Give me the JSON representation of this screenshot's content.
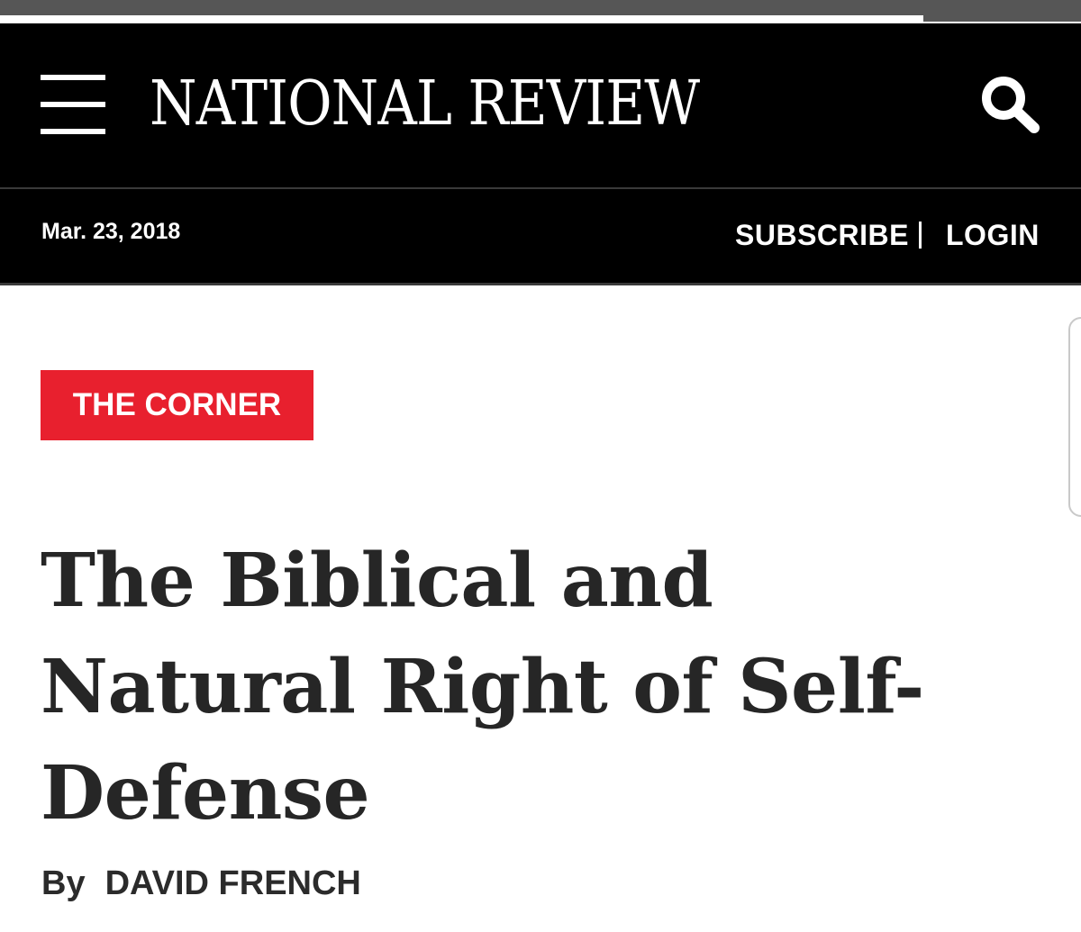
{
  "header": {
    "logo_text": "NATIONAL REVIEW",
    "menu_icon": "hamburger-menu-icon",
    "search_icon": "search-icon",
    "background_color": "#000000"
  },
  "subbar": {
    "date": "Mar. 23, 2018",
    "subscribe_label": "SUBSCRIBE",
    "separator": "|",
    "login_label": "LOGIN"
  },
  "article": {
    "section_label": "THE CORNER",
    "section_color": "#e8202e",
    "headline": "The Biblical and Natural Right of Self-Defense",
    "byline_prefix": "By",
    "author": "DAVID FRENCH"
  }
}
